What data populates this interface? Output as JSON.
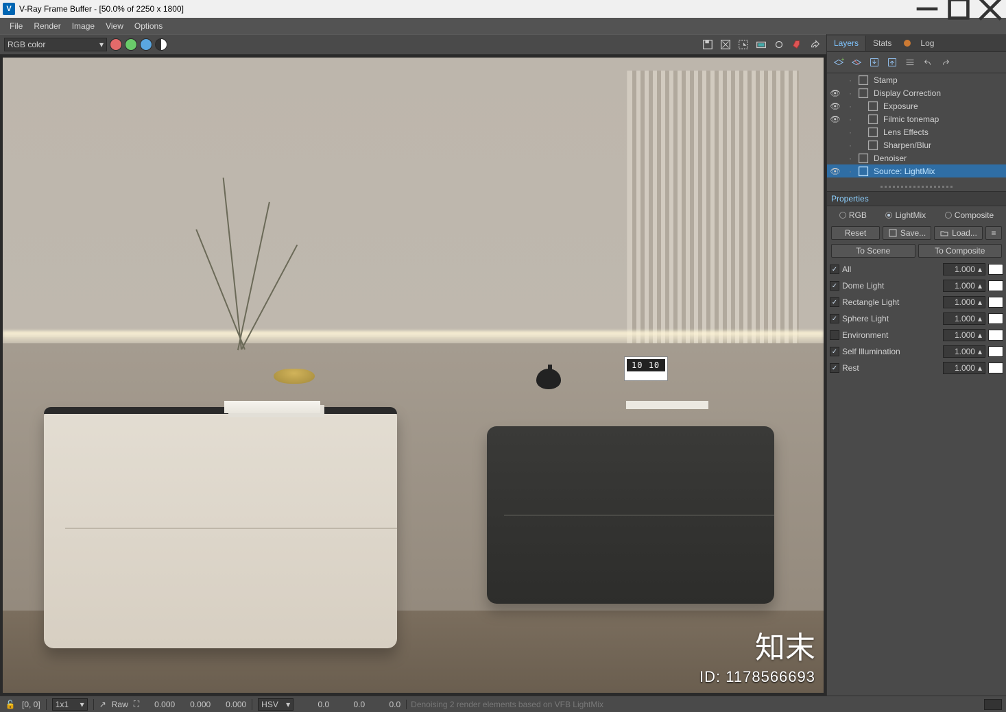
{
  "window": {
    "title": "V-Ray Frame Buffer - [50.0% of 2250 x 1800]"
  },
  "menu": {
    "items": [
      "File",
      "Render",
      "Image",
      "View",
      "Options"
    ]
  },
  "toolbar": {
    "channel": "RGB color",
    "icons": {
      "red": "red-channel",
      "green": "green-channel",
      "blue": "blue-channel",
      "mono": "mono-channel",
      "save": "save-icon",
      "dup": "duplicate-icon",
      "region": "region-render-icon",
      "track": "track-mouse-icon",
      "link": "link-pdplayer-icon",
      "bucket": "stop-icon",
      "teapot": "render-last-icon"
    }
  },
  "side": {
    "tabs": {
      "layers": "Layers",
      "stats": "Stats",
      "log": "Log"
    },
    "layers": [
      {
        "label": "Stamp",
        "visible": false,
        "selected": false
      },
      {
        "label": "Display Correction",
        "visible": true,
        "selected": false
      },
      {
        "label": "Exposure",
        "visible": true,
        "selected": false,
        "indent": true
      },
      {
        "label": "Filmic tonemap",
        "visible": true,
        "selected": false,
        "indent": true
      },
      {
        "label": "Lens Effects",
        "visible": false,
        "selected": false,
        "indent": true
      },
      {
        "label": "Sharpen/Blur",
        "visible": false,
        "selected": false,
        "indent": true
      },
      {
        "label": "Denoiser",
        "visible": false,
        "selected": false
      },
      {
        "label": "Source: LightMix",
        "visible": true,
        "selected": true
      }
    ],
    "properties": {
      "title": "Properties",
      "mode": {
        "rgb": "RGB",
        "lightmix": "LightMix",
        "composite": "Composite",
        "active": "lightmix"
      },
      "buttons": {
        "reset": "Reset",
        "save": "Save...",
        "load": "Load..."
      },
      "scene": {
        "to_scene": "To Scene",
        "to_composite": "To Composite"
      },
      "rows": [
        {
          "checked": true,
          "name": "All",
          "value": "1.000",
          "swatch": "#ffffff"
        },
        {
          "checked": true,
          "name": "Dome Light",
          "value": "1.000",
          "swatch": "#ffffff"
        },
        {
          "checked": true,
          "name": "Rectangle Light",
          "value": "1.000",
          "swatch": "#ffffff"
        },
        {
          "checked": true,
          "name": "Sphere Light",
          "value": "1.000",
          "swatch": "#ffffff"
        },
        {
          "checked": false,
          "name": "Environment",
          "value": "1.000",
          "swatch": "#ffffff"
        },
        {
          "checked": true,
          "name": "Self Illumination",
          "value": "1.000",
          "swatch": "#ffffff"
        },
        {
          "checked": true,
          "name": "Rest",
          "value": "1.000",
          "swatch": "#ffffff"
        }
      ]
    }
  },
  "status": {
    "coords": "[0, 0]",
    "zoom": "1x1",
    "raw": "Raw",
    "raw_vals": [
      "0.000",
      "0.000",
      "0.000"
    ],
    "space": "HSV",
    "space_vals": [
      "0.0",
      "0.0",
      "0.0"
    ],
    "message": "Denoising 2 render elements based on VFB LightMix"
  },
  "overlay": {
    "brand_cn": "知末",
    "id_label": "ID: 1178566693"
  }
}
